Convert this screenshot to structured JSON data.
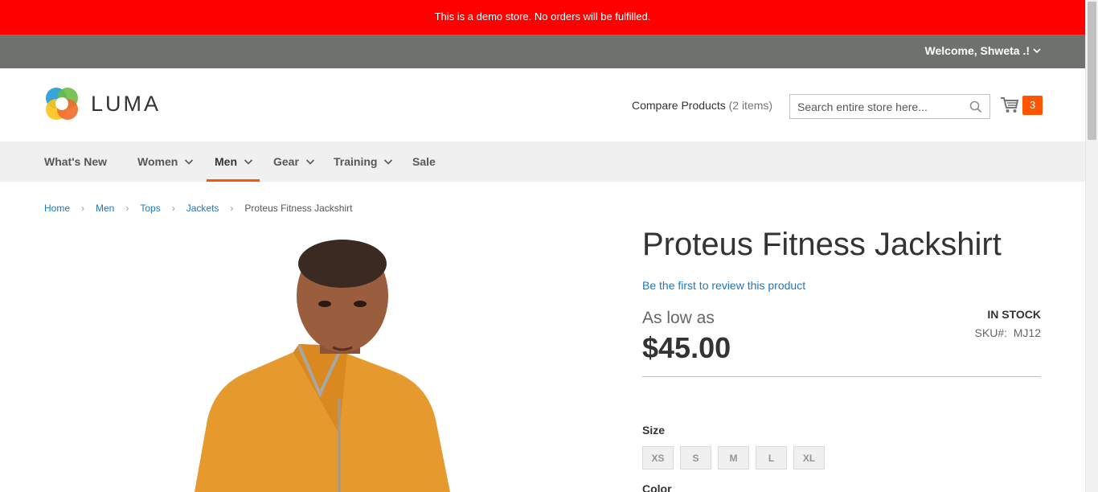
{
  "notice": "This is a demo store. No orders will be fulfilled.",
  "header": {
    "welcome": "Welcome, Shweta .!",
    "logo_text": "LUMA",
    "compare_label": "Compare Products",
    "compare_count": "(2 items)",
    "search_placeholder": "Search entire store here...",
    "cart_count": "3"
  },
  "nav": {
    "items": [
      {
        "label": "What's New"
      },
      {
        "label": "Women"
      },
      {
        "label": "Men"
      },
      {
        "label": "Gear"
      },
      {
        "label": "Training"
      },
      {
        "label": "Sale"
      }
    ],
    "active": "Men"
  },
  "breadcrumbs": [
    "Home",
    "Men",
    "Tops",
    "Jackets",
    "Proteus Fitness Jackshirt"
  ],
  "product": {
    "title": "Proteus Fitness Jackshirt",
    "review_link": "Be the first to review this product",
    "price_prefix": "As low as",
    "price": "$45.00",
    "stock": "IN STOCK",
    "sku_label": "SKU#:",
    "sku": "MJ12",
    "size_label": "Size",
    "sizes": [
      "XS",
      "S",
      "M",
      "L",
      "XL"
    ],
    "color_label": "Color"
  },
  "colors": {
    "notice_bg": "#ff0000",
    "panel_bg": "#6e716e",
    "accent": "#ff5501",
    "link": "#1979c3"
  }
}
